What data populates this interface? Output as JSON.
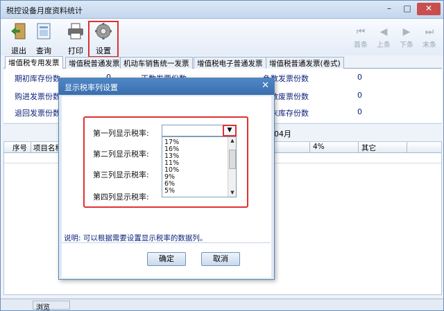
{
  "window": {
    "title": "税控设备月度资料统计",
    "minimize": "–",
    "maximize": "□",
    "close": "✕"
  },
  "toolbar": {
    "exit": "退出",
    "query": "查询",
    "print": "打印",
    "settings": "设置",
    "first": "首条",
    "prev": "上条",
    "next": "下条",
    "last": "末条"
  },
  "tabs": [
    "增值税专用发票",
    "增值税普通发票",
    "机动车销售统一发票",
    "增值税电子普通发票",
    "增值税普通发票(卷式)"
  ],
  "summary": {
    "left": [
      "期初库存份数",
      "购进发票份数",
      "退回发票份数"
    ],
    "right_labels": [
      "负数发票份数",
      "负数废票份数",
      "期末库存份数"
    ],
    "right_values": [
      "0",
      "0",
      "0"
    ],
    "middle_partial": "正数发票份数",
    "middle_value": "0"
  },
  "band_text": "04月",
  "grid_headers": [
    "序号",
    "项目名称",
    "4%",
    "其它"
  ],
  "status": {
    "browse": "浏览"
  },
  "dialog": {
    "title": "显示税率列设置",
    "close": "✕",
    "rows": [
      "第一列显示税率:",
      "第二列显示税率:",
      "第三列显示税率:",
      "第四列显示税率:"
    ],
    "options": [
      "17%",
      "16%",
      "13%",
      "11%",
      "10%",
      "9%",
      "6%",
      "5%"
    ],
    "note": "说明: 可以根据需要设置显示税率的数据列。",
    "ok": "确定",
    "cancel": "取消"
  },
  "colors": {
    "label": "#0a1f7a",
    "highlight": "#e03030",
    "title_bar": "#3a6fae"
  }
}
